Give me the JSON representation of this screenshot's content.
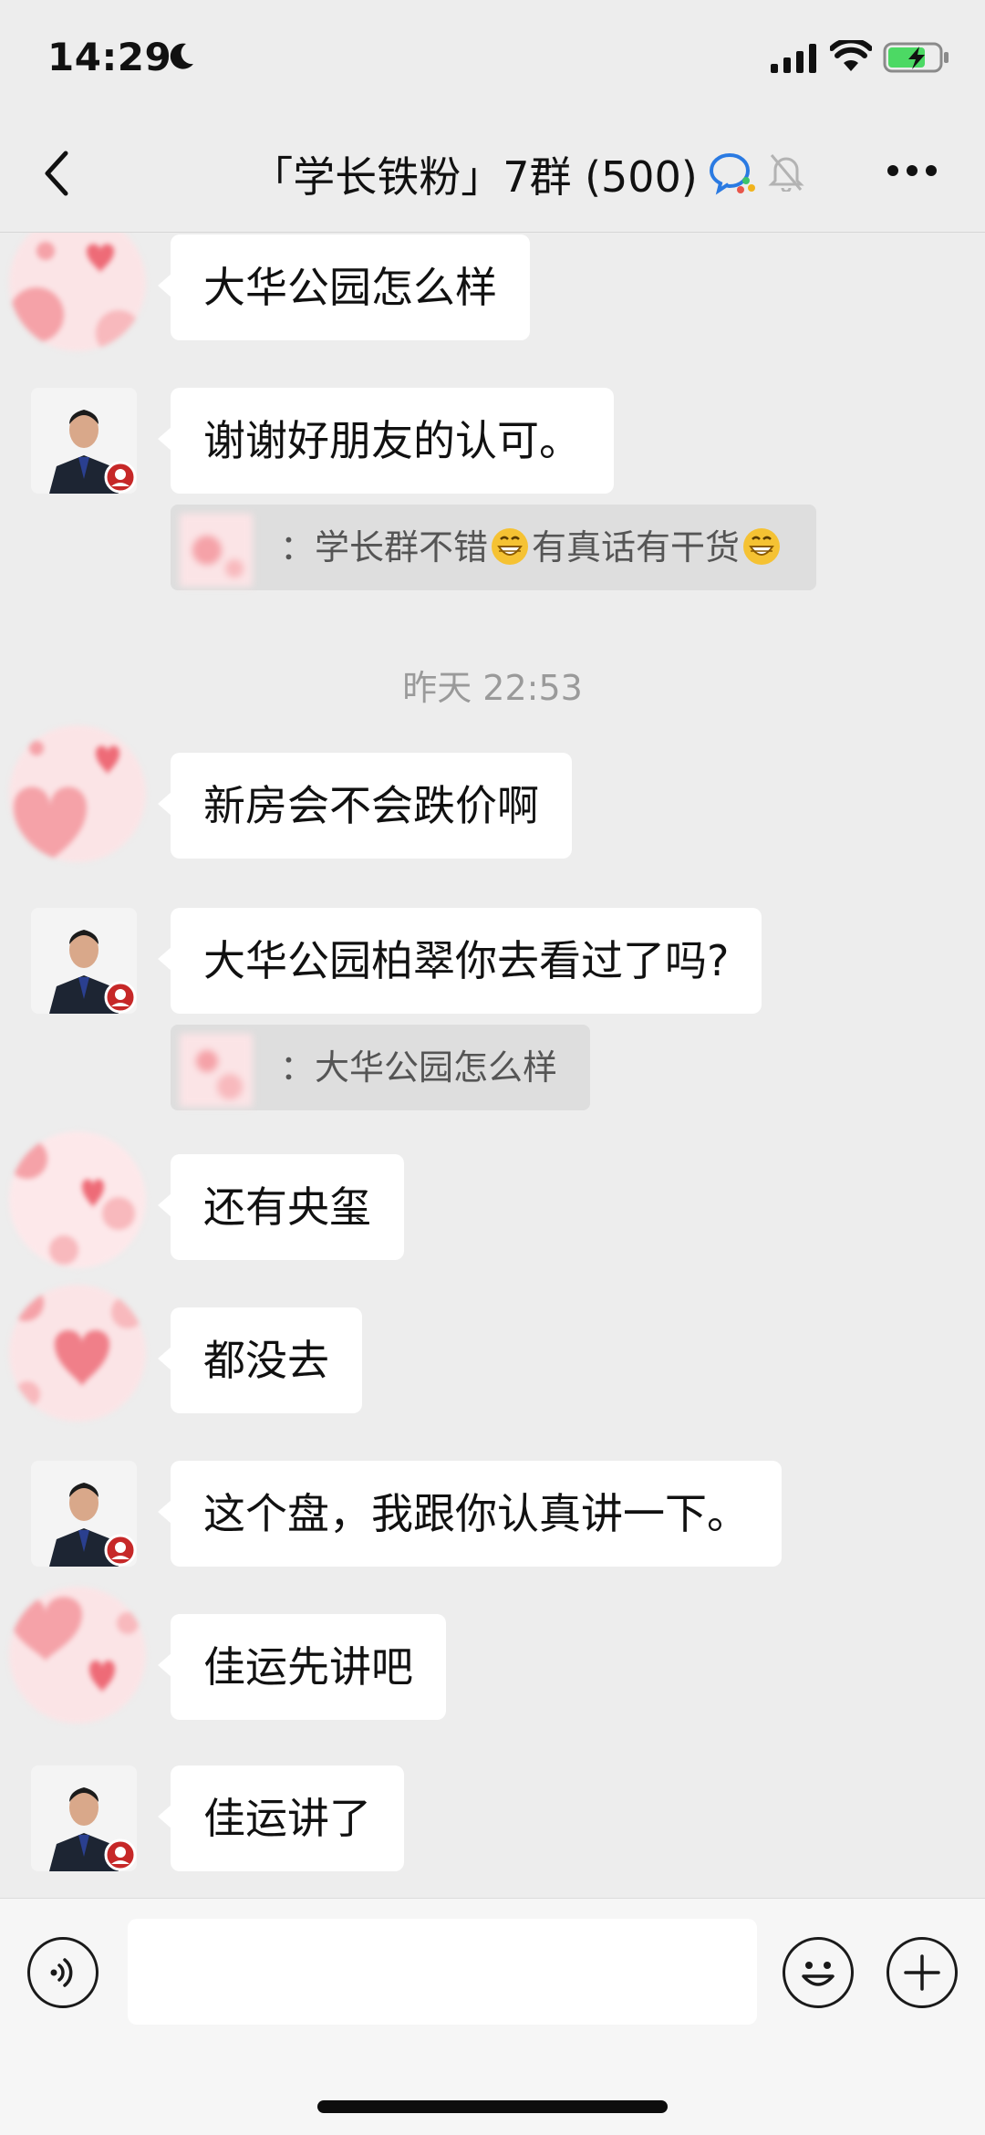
{
  "status_bar": {
    "time": "14:29"
  },
  "header": {
    "title": "「学长铁粉」7群 (500)"
  },
  "messages": [
    {
      "sender": "friend",
      "text": "大华公园怎么样"
    },
    {
      "sender": "agent",
      "text": "谢谢好朋友的认可。",
      "quote": {
        "prefix": "：学长群不错",
        "middle": "有真话有干货"
      }
    },
    {
      "time_divider": "昨天 22:53"
    },
    {
      "sender": "friend",
      "text": "新房会不会跌价啊"
    },
    {
      "sender": "agent",
      "text": "大华公园柏翠你去看过了吗?",
      "quote": {
        "prefix": "：大华公园怎么样"
      }
    },
    {
      "sender": "friend",
      "text": "还有央玺"
    },
    {
      "sender": "friend",
      "text": "都没去"
    },
    {
      "sender": "agent",
      "text": "这个盘，我跟你认真讲一下。"
    },
    {
      "sender": "friend",
      "text": "佳运先讲吧"
    },
    {
      "sender": "agent",
      "text": "佳运讲了"
    }
  ],
  "input_bar": {
    "value": ""
  },
  "colors": {
    "background": "#ededed",
    "bubble": "#ffffff",
    "quote": "#dedede",
    "battery": "#4cd964"
  }
}
